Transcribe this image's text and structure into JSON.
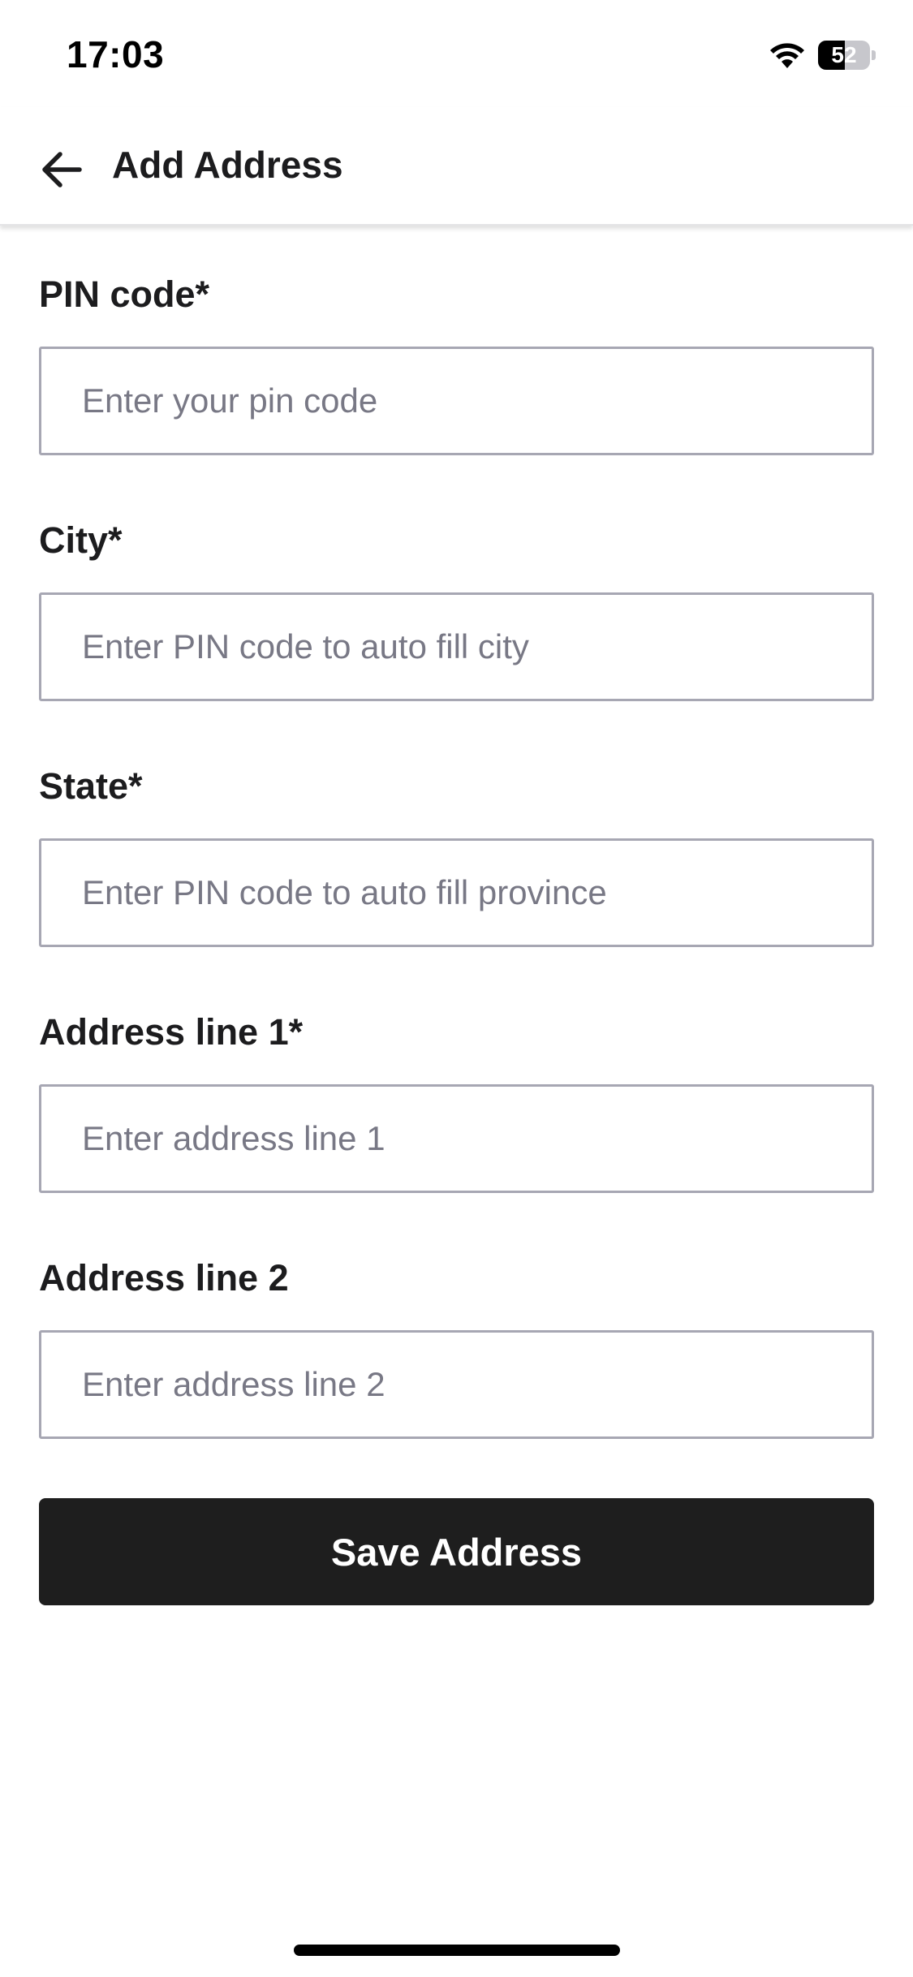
{
  "status_bar": {
    "time": "17:03",
    "battery_level": "52",
    "battery_fraction": 0.52,
    "icons": [
      "wifi-icon",
      "battery-icon"
    ]
  },
  "header": {
    "title": "Add Address",
    "back_icon": "arrow-left-icon"
  },
  "form": {
    "fields": [
      {
        "label": "PIN code*",
        "placeholder": "Enter your pin code",
        "value": ""
      },
      {
        "label": "City*",
        "placeholder": "Enter PIN code to auto fill city",
        "value": ""
      },
      {
        "label": "State*",
        "placeholder": "Enter PIN code to auto fill province",
        "value": ""
      },
      {
        "label": "Address line 1*",
        "placeholder": "Enter address line 1",
        "value": ""
      },
      {
        "label": "Address line 2",
        "placeholder": "Enter address line 2",
        "value": ""
      }
    ]
  },
  "actions": {
    "save_label": "Save Address"
  },
  "colors": {
    "primary_button": "#1e1e1e",
    "input_border": "#a7a7b3",
    "placeholder": "#787885",
    "text": "#1c1c1e"
  }
}
